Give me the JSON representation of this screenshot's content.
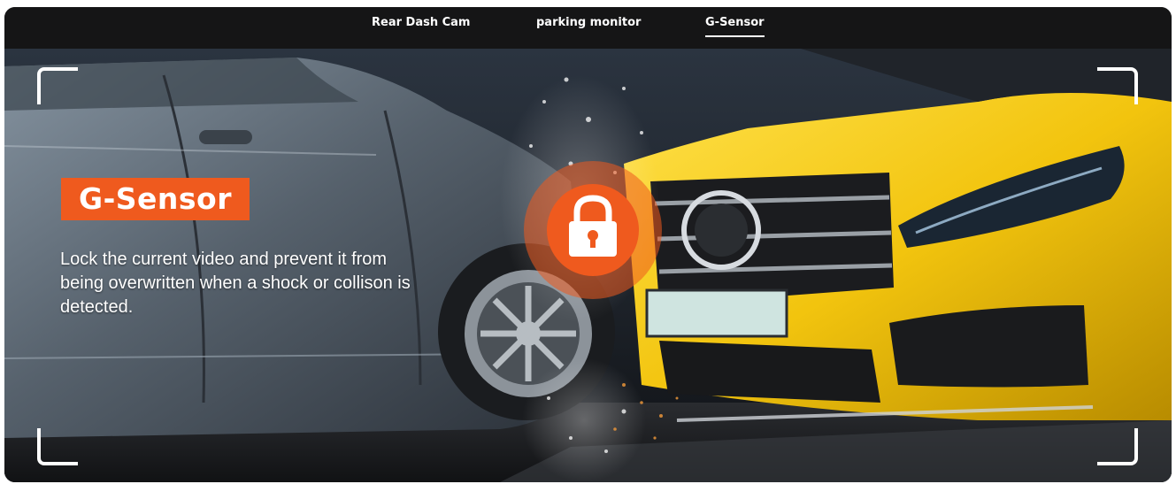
{
  "tabs": [
    {
      "label": "Rear Dash Cam",
      "active": false
    },
    {
      "label": "parking monitor",
      "active": false
    },
    {
      "label": "G-Sensor",
      "active": true
    }
  ],
  "feature": {
    "title": "G-Sensor",
    "description": "Lock the current video and prevent it from being overwritten when a shock or collison is detected."
  },
  "icons": {
    "lock": "lock-icon"
  },
  "colors": {
    "accent": "#ef5a1e",
    "topbar": "#151516",
    "yellow_car": "#f2c40e",
    "grey_car": "#5c6670"
  }
}
